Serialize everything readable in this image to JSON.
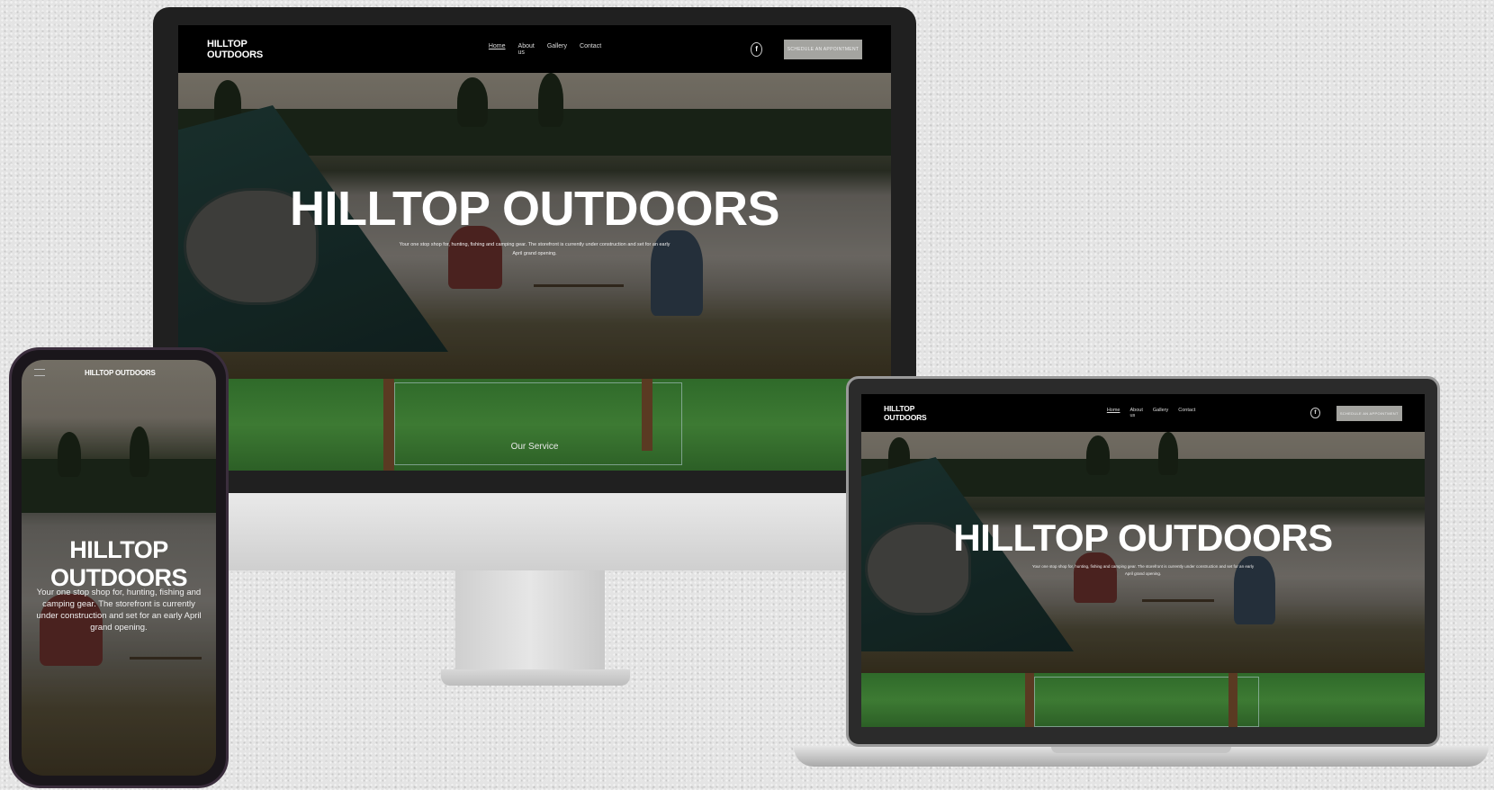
{
  "site": {
    "logo": "HILLTOP OUTDOORS",
    "nav": [
      "Home",
      "About us",
      "Gallery",
      "Contact"
    ],
    "facebook_glyph": "f",
    "cta": "SCHEDULE AN APPOINTMENT",
    "hero_title": "HILLTOP OUTDOORS",
    "hero_text": "Your one stop shop for, hunting, fishing and camping gear. The storefront is currently under construction and set for an early April grand opening.",
    "section_label": "Our Service",
    "phone_menu_icon": "hamburger-menu-icon"
  },
  "colors": {
    "nav_bg": "#000000",
    "cta_bg": "#a4a4a0",
    "field_green": "#3d7a33"
  }
}
